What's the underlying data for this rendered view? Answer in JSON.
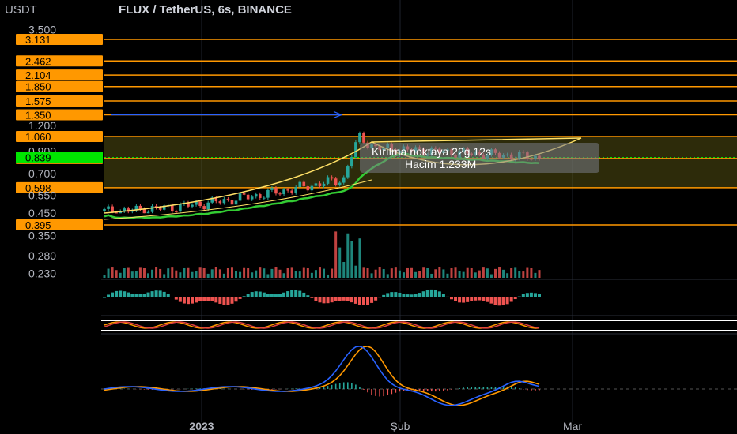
{
  "header": {
    "unit": "USDT",
    "title": "FLUX / TetherUS, 6s, BINANCE"
  },
  "colors": {
    "background": "#000000",
    "level_line": "#ff9800",
    "current_price": "#00e600",
    "bull_candle": "#26a69a",
    "bear_candle": "#ef5350",
    "ma_green": "#33cc33",
    "macd_line": "#2962ff",
    "signal_line": "#ff9800"
  },
  "chart_data": {
    "type": "candlestick",
    "symbol": "FLUX / TetherUS",
    "interval": "6s",
    "exchange": "BINANCE",
    "y_scale": "log",
    "x_labels": [
      "2023",
      "Şub",
      "Mar"
    ],
    "price_axis_labels": [
      "3.500",
      "1.200",
      "0.900",
      "0.700",
      "0.550",
      "0.450",
      "0.350",
      "0.280",
      "0.230"
    ],
    "price_levels": [
      "3.131",
      "2.462",
      "2.104",
      "1.850",
      "1.575",
      "1.350",
      "1.060",
      "0.829",
      "0.598",
      "0.395"
    ],
    "current_price": "0.839",
    "tooltip": {
      "line1": "Kırılma noktaya 22g 12s",
      "line2": "Hacim 1.233M"
    },
    "shown_window": {
      "low": 0.45,
      "high": 1.12
    },
    "panes": [
      "volume",
      "histogram_oscillator",
      "stochastic_oscillator",
      "macd"
    ]
  }
}
